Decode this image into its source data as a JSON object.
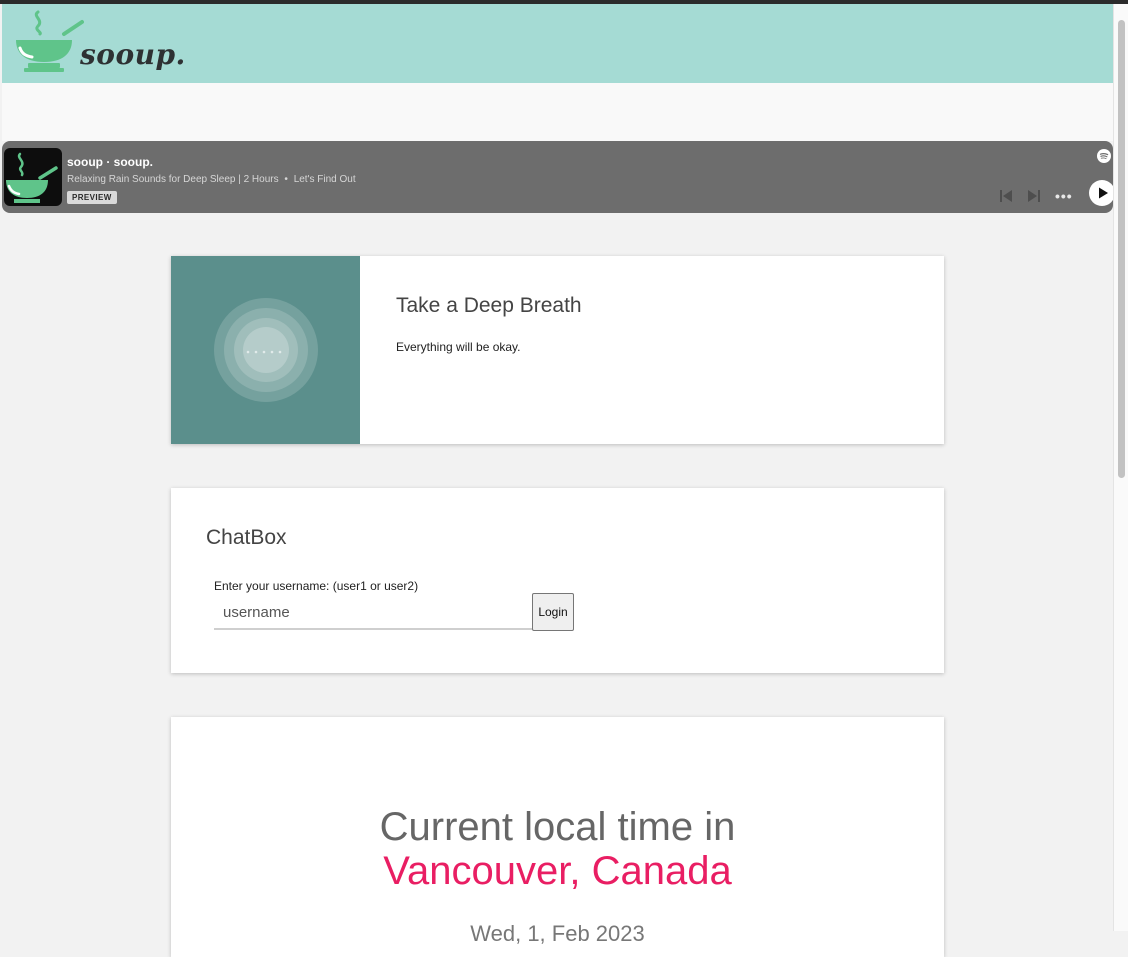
{
  "header": {
    "brand": "sooup.",
    "brand_color": "#5fc48a",
    "background": "#a5dbd4"
  },
  "player": {
    "title": "sooup · sooup.",
    "track": "Relaxing Rain Sounds for Deep Sleep | 2 Hours",
    "separator": "•",
    "secondary": "Let's Find Out",
    "badge": "PREVIEW",
    "more_label": "•••",
    "icons": [
      "spotify-icon",
      "previous-icon",
      "next-icon",
      "more-icon",
      "play-icon"
    ]
  },
  "breath_card": {
    "title": "Take a Deep Breath",
    "text": "Everything will be okay."
  },
  "chatbox": {
    "title": "ChatBox",
    "label": "Enter your username: (user1 or user2)",
    "input_placeholder": "username",
    "input_value": "",
    "login_label": "Login"
  },
  "time_card": {
    "heading": "Current local time in",
    "city": "Vancouver, Canada",
    "date": "Wed, 1, Feb 2023",
    "city_color": "#e91e63"
  }
}
